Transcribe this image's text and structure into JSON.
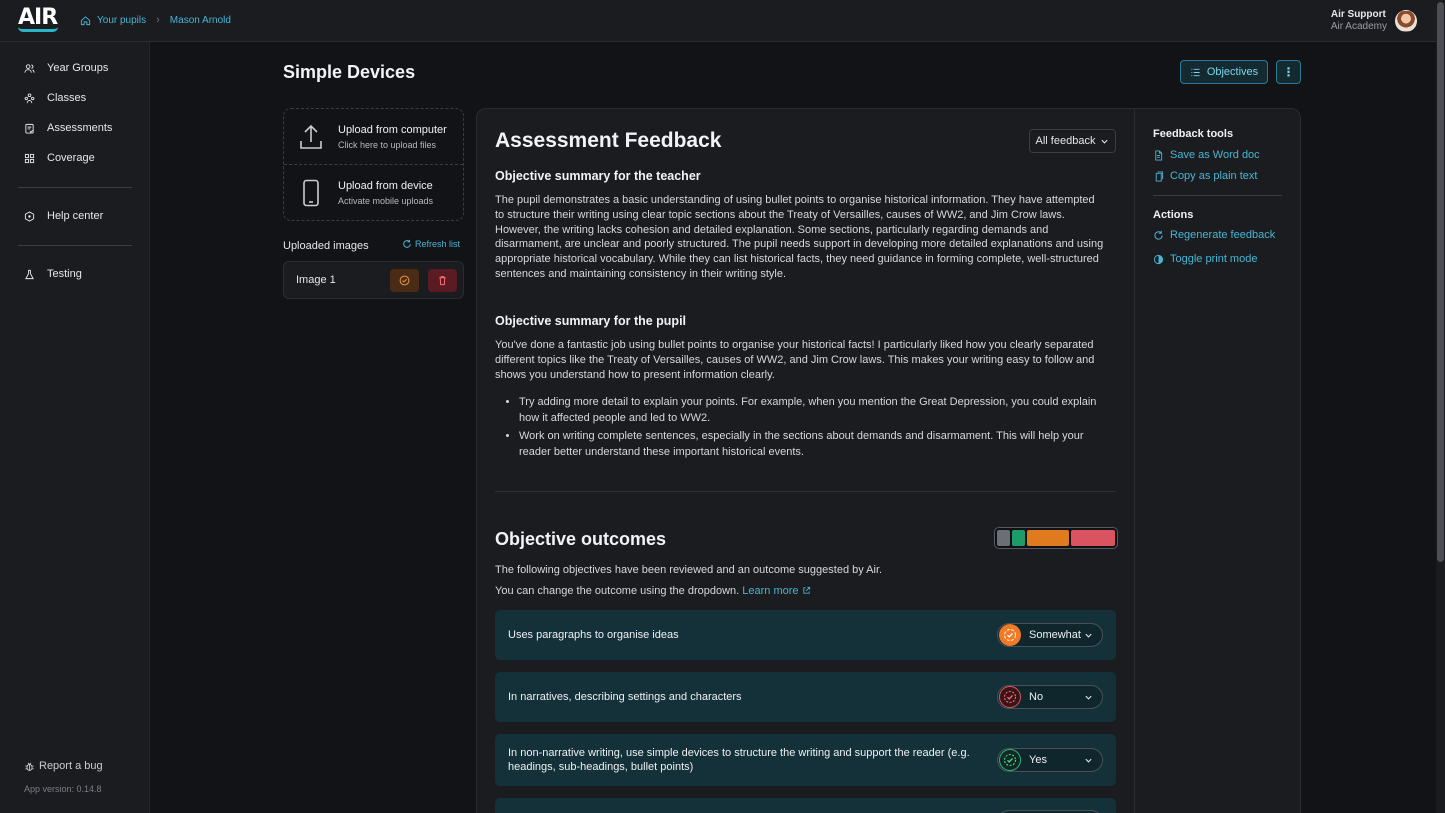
{
  "brand": {
    "logo_text": "AIR",
    "accent": "#2bb3c6"
  },
  "breadcrumb": {
    "home": "Your pupils",
    "current": "Mason Arnold"
  },
  "user": {
    "name": "Air Support",
    "org": "Air Academy"
  },
  "sidebar": {
    "items": [
      {
        "label": "Year Groups",
        "icon": "users-icon"
      },
      {
        "label": "Classes",
        "icon": "classes-icon"
      },
      {
        "label": "Assessments",
        "icon": "assessment-icon"
      },
      {
        "label": "Coverage",
        "icon": "grid-icon"
      },
      {
        "label": "Help center",
        "icon": "help-icon"
      },
      {
        "label": "Testing",
        "icon": "flask-icon"
      }
    ],
    "report_bug": "Report a bug",
    "version": "App version: 0.14.8"
  },
  "page": {
    "title": "Simple Devices",
    "objectives_button": "Objectives"
  },
  "upload": {
    "computer_title": "Upload from computer",
    "computer_sub": "Click here to upload files",
    "device_title": "Upload from device",
    "device_sub": "Activate mobile uploads",
    "uploaded_label": "Uploaded images",
    "refresh": "Refresh list",
    "images": [
      {
        "name": "Image 1"
      }
    ]
  },
  "feedback": {
    "title": "Assessment Feedback",
    "filter": "All feedback",
    "teacher_heading": "Objective summary for the teacher",
    "teacher_text": "The pupil demonstrates a basic understanding of using bullet points to organise historical information. They have attempted to structure their writing using clear topic sections about the Treaty of Versailles, causes of WW2, and Jim Crow laws. However, the writing lacks cohesion and detailed explanation. Some sections, particularly regarding demands and disarmament, are unclear and poorly structured. The pupil needs support in developing more detailed explanations and using appropriate historical vocabulary. While they can list historical facts, they need guidance in forming complete, well-structured sentences and maintaining consistency in their writing style.",
    "pupil_heading": "Objective summary for the pupil",
    "pupil_text": "You've done a fantastic job using bullet points to organise your historical facts! I particularly liked how you clearly separated different topics like the Treaty of Versailles, causes of WW2, and Jim Crow laws. This makes your writing easy to follow and shows you understand how to present information clearly.",
    "pupil_bullets": [
      "Try adding more detail to explain your points. For example, when you mention the Great Depression, you could explain how it affected people and led to WW2.",
      "Work on writing complete sentences, especially in the sections about demands and disarmament. This will help your reader better understand these important historical events."
    ]
  },
  "outcomes": {
    "title": "Objective outcomes",
    "intro1": "The following objectives have been reviewed and an outcome suggested by Air.",
    "intro2": "You can change the outcome using the dropdown.",
    "learn_more": "Learn more",
    "bar_colors": {
      "grey": "#6b6e74",
      "green": "#1f9a6a",
      "orange": "#e07a1f",
      "red": "#d9545e"
    },
    "rows": [
      {
        "label": "Uses paragraphs to organise ideas",
        "value": "Somewhat",
        "status": "somewhat"
      },
      {
        "label": "In narratives, describing settings and characters",
        "value": "No",
        "status": "no"
      },
      {
        "label": "In non-narrative writing, use simple devices to structure the writing and support the reader (e.g. headings, sub-headings, bullet points)",
        "value": "Yes",
        "status": "yes"
      }
    ]
  },
  "tools": {
    "feedback_heading": "Feedback tools",
    "save_word": "Save as Word doc",
    "copy_text": "Copy as plain text",
    "actions_heading": "Actions",
    "regenerate": "Regenerate feedback",
    "print_mode": "Toggle print mode"
  }
}
